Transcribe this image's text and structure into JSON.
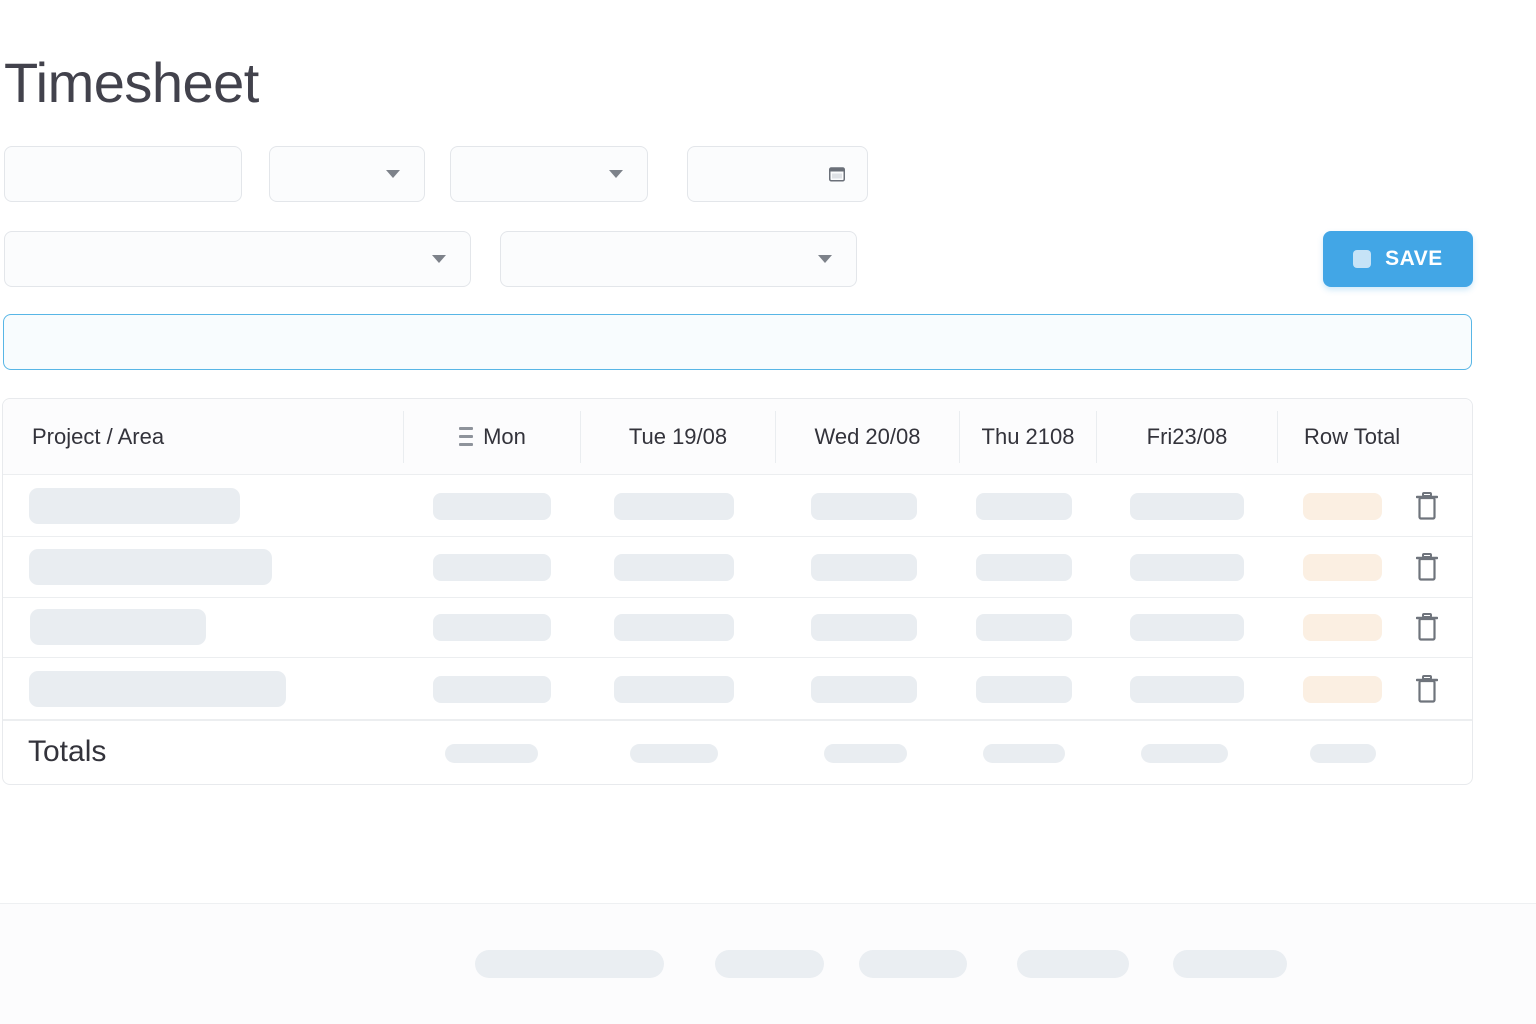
{
  "page": {
    "title": "Timesheet"
  },
  "toolbar": {
    "save_label": "SAVE"
  },
  "table": {
    "headers": {
      "project": "Project / Area",
      "mon": "Mon",
      "tue": "Tue 19/08",
      "wed": "Wed 20/08",
      "thu": "Thu 2108",
      "fri": "Fri23/08",
      "total": "Row Total"
    },
    "totals_label": "Totals"
  },
  "colors": {
    "accent": "#42a6e6",
    "search_border": "#58b6e6",
    "placeholder": "#e9edf1",
    "row_total_placeholder": "#fbefe2",
    "text": "#33333b"
  },
  "icons": {
    "date_picker": "calendar-icon",
    "dropdown": "chevron-down-icon",
    "save": "save-icon",
    "delete_row": "trash-icon",
    "column_menu": "list-icon"
  }
}
